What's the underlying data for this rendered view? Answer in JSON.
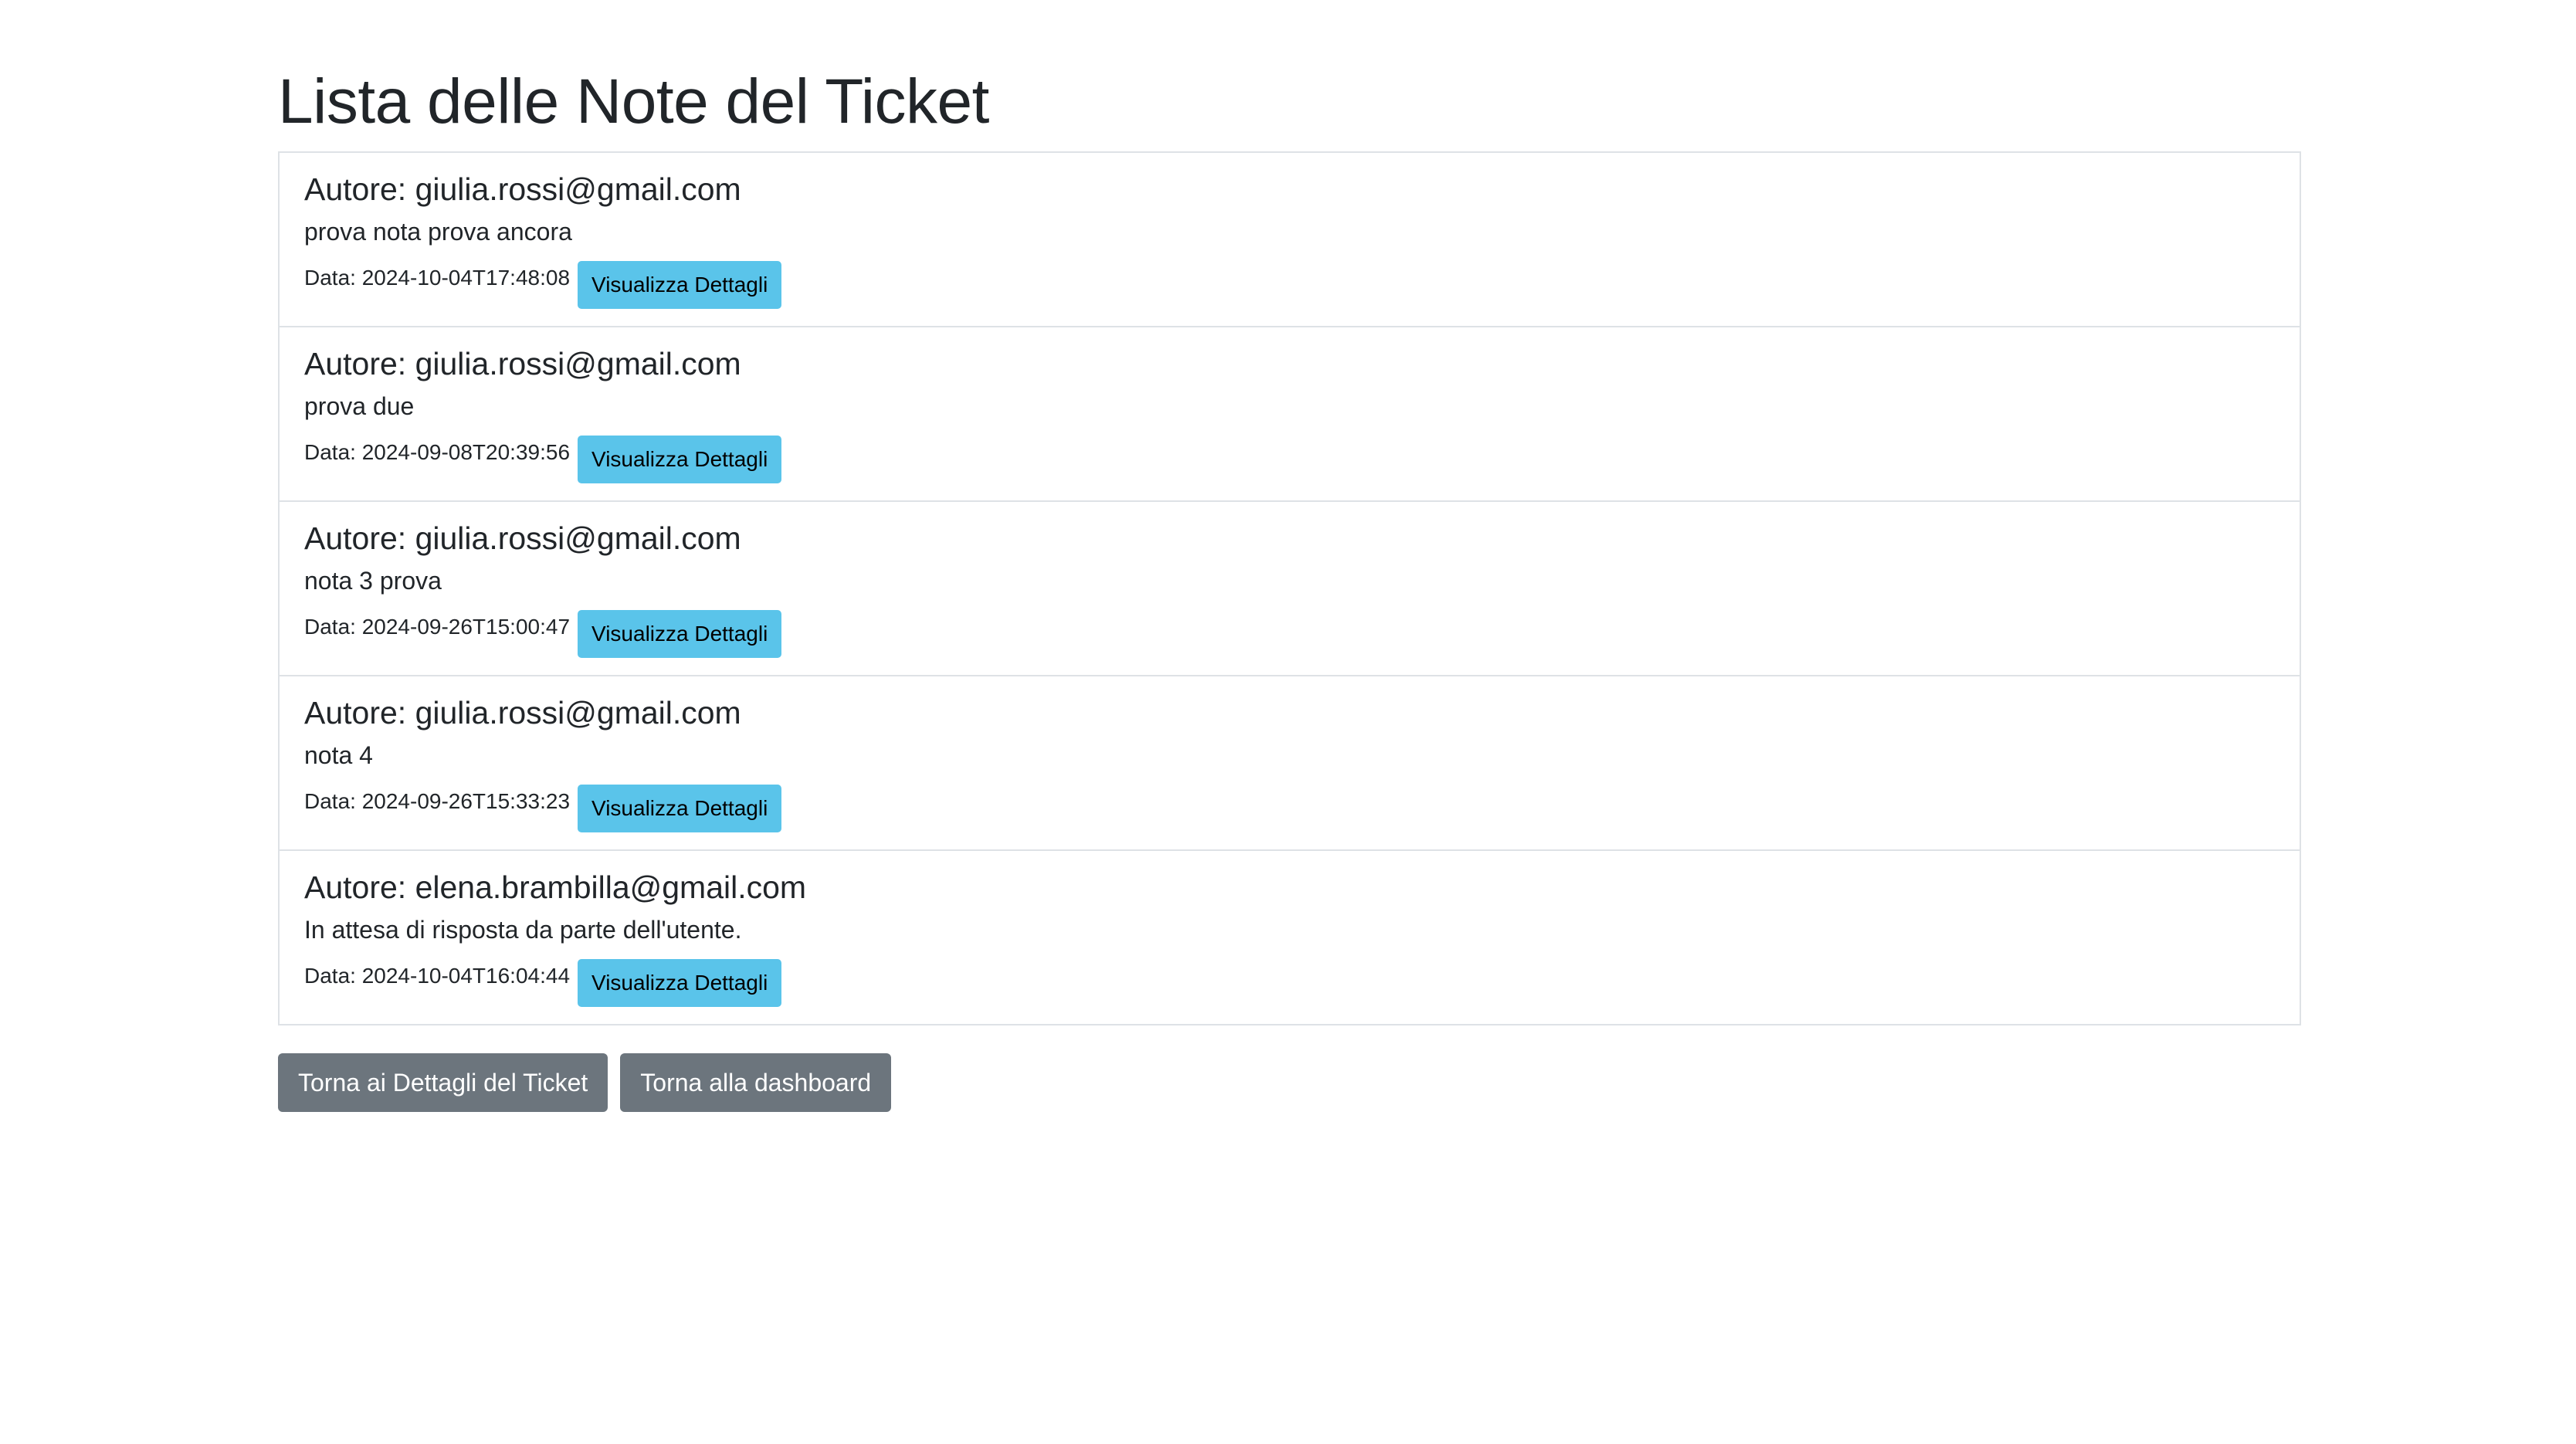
{
  "page": {
    "title": "Lista delle Note del Ticket"
  },
  "notes": [
    {
      "author": "Autore: giulia.rossi@gmail.com",
      "text": "prova nota prova ancora",
      "date": "Data: 2024-10-04T17:48:08",
      "details_label": "Visualizza Dettagli"
    },
    {
      "author": "Autore: giulia.rossi@gmail.com",
      "text": "prova due",
      "date": "Data: 2024-09-08T20:39:56",
      "details_label": "Visualizza Dettagli"
    },
    {
      "author": "Autore: giulia.rossi@gmail.com",
      "text": "nota 3 prova",
      "date": "Data: 2024-09-26T15:00:47",
      "details_label": "Visualizza Dettagli"
    },
    {
      "author": "Autore: giulia.rossi@gmail.com",
      "text": "nota 4",
      "date": "Data: 2024-09-26T15:33:23",
      "details_label": "Visualizza Dettagli"
    },
    {
      "author": "Autore: elena.brambilla@gmail.com",
      "text": "In attesa di risposta da parte dell'utente.",
      "date": "Data: 2024-10-04T16:04:44",
      "details_label": "Visualizza Dettagli"
    }
  ],
  "actions": {
    "back_to_ticket_label": "Torna ai Dettagli del Ticket",
    "back_to_dashboard_label": "Torna alla dashboard"
  },
  "colors": {
    "info_button": "#5ac4ea",
    "secondary_button": "#6c757d",
    "border": "#dee2e6",
    "text": "#212529"
  }
}
